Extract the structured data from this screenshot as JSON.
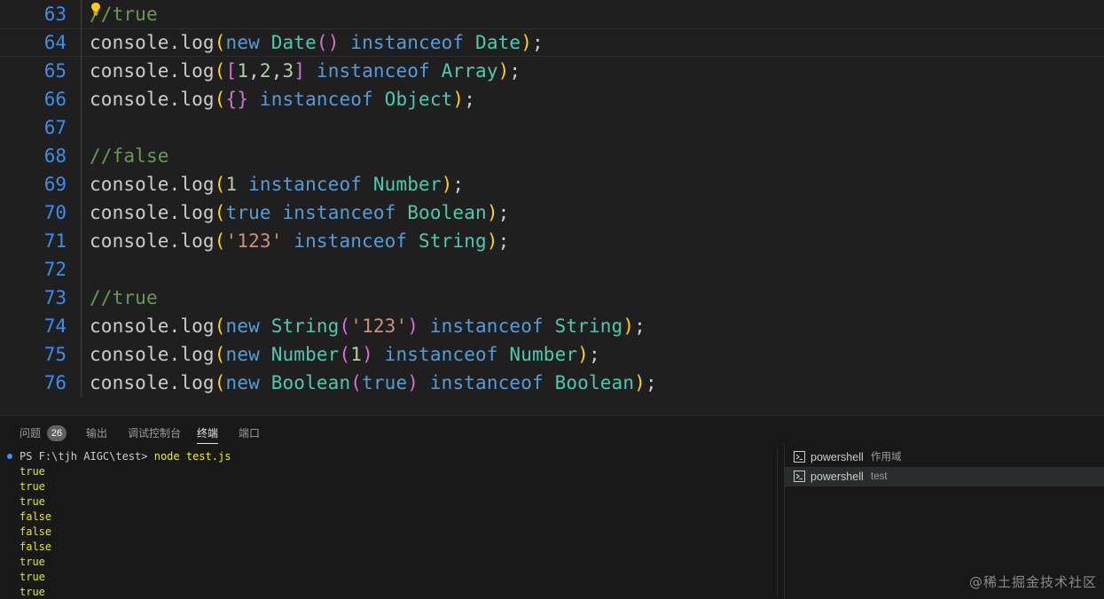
{
  "editor": {
    "lines": [
      {
        "num": "63",
        "tokens": [
          {
            "t": "//true",
            "c": "cmt"
          }
        ]
      },
      {
        "num": "64",
        "tokens": [
          {
            "t": "console.log",
            "c": "def"
          },
          {
            "t": "(",
            "c": "p1"
          },
          {
            "t": "new ",
            "c": "kw"
          },
          {
            "t": "Date",
            "c": "cls"
          },
          {
            "t": "()",
            "c": "p2"
          },
          {
            "t": " ",
            "c": "def"
          },
          {
            "t": "instanceof",
            "c": "kw"
          },
          {
            "t": " ",
            "c": "def"
          },
          {
            "t": "Date",
            "c": "cls"
          },
          {
            "t": ")",
            "c": "p1"
          },
          {
            "t": ";",
            "c": "def"
          }
        ]
      },
      {
        "num": "65",
        "tokens": [
          {
            "t": "console.log",
            "c": "def"
          },
          {
            "t": "(",
            "c": "p1"
          },
          {
            "t": "[",
            "c": "p2"
          },
          {
            "t": "1",
            "c": "num"
          },
          {
            "t": ",",
            "c": "def"
          },
          {
            "t": "2",
            "c": "num"
          },
          {
            "t": ",",
            "c": "def"
          },
          {
            "t": "3",
            "c": "num"
          },
          {
            "t": "]",
            "c": "p2"
          },
          {
            "t": " ",
            "c": "def"
          },
          {
            "t": "instanceof",
            "c": "kw"
          },
          {
            "t": " ",
            "c": "def"
          },
          {
            "t": "Array",
            "c": "cls"
          },
          {
            "t": ")",
            "c": "p1"
          },
          {
            "t": ";",
            "c": "def"
          }
        ]
      },
      {
        "num": "66",
        "tokens": [
          {
            "t": "console.log",
            "c": "def"
          },
          {
            "t": "(",
            "c": "p1"
          },
          {
            "t": "{}",
            "c": "p2"
          },
          {
            "t": " ",
            "c": "def"
          },
          {
            "t": "instanceof",
            "c": "kw"
          },
          {
            "t": " ",
            "c": "def"
          },
          {
            "t": "Object",
            "c": "cls"
          },
          {
            "t": ")",
            "c": "p1"
          },
          {
            "t": ";",
            "c": "def"
          }
        ]
      },
      {
        "num": "67",
        "tokens": []
      },
      {
        "num": "68",
        "tokens": [
          {
            "t": "//false",
            "c": "cmt"
          }
        ]
      },
      {
        "num": "69",
        "tokens": [
          {
            "t": "console.log",
            "c": "def"
          },
          {
            "t": "(",
            "c": "p1"
          },
          {
            "t": "1",
            "c": "num"
          },
          {
            "t": " ",
            "c": "def"
          },
          {
            "t": "instanceof",
            "c": "kw"
          },
          {
            "t": " ",
            "c": "def"
          },
          {
            "t": "Number",
            "c": "cls"
          },
          {
            "t": ")",
            "c": "p1"
          },
          {
            "t": ";",
            "c": "def"
          }
        ]
      },
      {
        "num": "70",
        "tokens": [
          {
            "t": "console.log",
            "c": "def"
          },
          {
            "t": "(",
            "c": "p1"
          },
          {
            "t": "true",
            "c": "kw"
          },
          {
            "t": " ",
            "c": "def"
          },
          {
            "t": "instanceof",
            "c": "kw"
          },
          {
            "t": " ",
            "c": "def"
          },
          {
            "t": "Boolean",
            "c": "cls"
          },
          {
            "t": ")",
            "c": "p1"
          },
          {
            "t": ";",
            "c": "def"
          }
        ]
      },
      {
        "num": "71",
        "tokens": [
          {
            "t": "console.log",
            "c": "def"
          },
          {
            "t": "(",
            "c": "p1"
          },
          {
            "t": "'123'",
            "c": "str"
          },
          {
            "t": " ",
            "c": "def"
          },
          {
            "t": "instanceof",
            "c": "kw"
          },
          {
            "t": " ",
            "c": "def"
          },
          {
            "t": "String",
            "c": "cls"
          },
          {
            "t": ")",
            "c": "p1"
          },
          {
            "t": ";",
            "c": "def"
          }
        ]
      },
      {
        "num": "72",
        "tokens": []
      },
      {
        "num": "73",
        "tokens": [
          {
            "t": "//true",
            "c": "cmt"
          }
        ]
      },
      {
        "num": "74",
        "tokens": [
          {
            "t": "console.log",
            "c": "def"
          },
          {
            "t": "(",
            "c": "p1"
          },
          {
            "t": "new ",
            "c": "kw"
          },
          {
            "t": "String",
            "c": "cls"
          },
          {
            "t": "(",
            "c": "p2"
          },
          {
            "t": "'123'",
            "c": "str"
          },
          {
            "t": ")",
            "c": "p2"
          },
          {
            "t": " ",
            "c": "def"
          },
          {
            "t": "instanceof",
            "c": "kw"
          },
          {
            "t": " ",
            "c": "def"
          },
          {
            "t": "String",
            "c": "cls"
          },
          {
            "t": ")",
            "c": "p1"
          },
          {
            "t": ";",
            "c": "def"
          }
        ]
      },
      {
        "num": "75",
        "tokens": [
          {
            "t": "console.log",
            "c": "def"
          },
          {
            "t": "(",
            "c": "p1"
          },
          {
            "t": "new ",
            "c": "kw"
          },
          {
            "t": "Number",
            "c": "cls"
          },
          {
            "t": "(",
            "c": "p2"
          },
          {
            "t": "1",
            "c": "num"
          },
          {
            "t": ")",
            "c": "p2"
          },
          {
            "t": " ",
            "c": "def"
          },
          {
            "t": "instanceof",
            "c": "kw"
          },
          {
            "t": " ",
            "c": "def"
          },
          {
            "t": "Number",
            "c": "cls"
          },
          {
            "t": ")",
            "c": "p1"
          },
          {
            "t": ";",
            "c": "def"
          }
        ]
      },
      {
        "num": "76",
        "tokens": [
          {
            "t": "console.log",
            "c": "def"
          },
          {
            "t": "(",
            "c": "p1"
          },
          {
            "t": "new ",
            "c": "kw"
          },
          {
            "t": "Boolean",
            "c": "cls"
          },
          {
            "t": "(",
            "c": "p2"
          },
          {
            "t": "true",
            "c": "kw"
          },
          {
            "t": ")",
            "c": "p2"
          },
          {
            "t": " ",
            "c": "def"
          },
          {
            "t": "instanceof",
            "c": "kw"
          },
          {
            "t": " ",
            "c": "def"
          },
          {
            "t": "Boolean",
            "c": "cls"
          },
          {
            "t": ")",
            "c": "p1"
          },
          {
            "t": ";",
            "c": "def"
          }
        ]
      }
    ]
  },
  "panel": {
    "tabs": {
      "problems": "问题",
      "problems_count": "26",
      "output": "输出",
      "debug_console": "调试控制台",
      "terminal": "终端",
      "ports": "端口"
    },
    "terminal": {
      "prompt": "PS F:\\tjh AIGC\\test> ",
      "command": "node test.js",
      "output": [
        "true",
        "true",
        "true",
        "false",
        "false",
        "false",
        "true",
        "true",
        "true"
      ]
    },
    "terminal_list": [
      {
        "name": "powershell",
        "desc": "作用域",
        "selected": false
      },
      {
        "name": "powershell",
        "desc": "test",
        "selected": true
      }
    ]
  },
  "watermark": "@稀土掘金技术社区",
  "colors": {
    "editor_bg": "#1f1f1f",
    "line_number": "#3b8eea",
    "keyword": "#569cd6",
    "class": "#4ec9b0",
    "comment": "#6a9955",
    "number": "#b5cea8",
    "string": "#ce9178",
    "bracket_level1": "#ffd700",
    "bracket_level2": "#da70d6",
    "terminal_output": "#e5e510"
  }
}
